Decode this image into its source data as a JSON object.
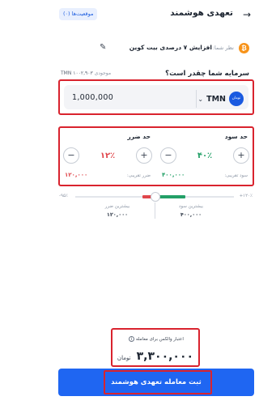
{
  "header": {
    "title": "تعهدی هوشمند",
    "positions_label": "موقعیت‌ها (۰)"
  },
  "opinion": {
    "label": "نظر شما:",
    "value": "افزایش ۷ درصدی بیت کوین",
    "coin_symbol": "₿"
  },
  "amount": {
    "question": "سرمایه شما چقدر است؟",
    "inventory_label": "موجودی",
    "inventory_value": "TMN ۱۰۰۲,۹۰۳",
    "value": "1,000,000",
    "currency": "TMN",
    "badge_text": "تومان"
  },
  "take_profit": {
    "title": "حد سود",
    "percent": "۴۰٪",
    "estimate_label": "سود تقریبی:",
    "estimate_value": "۴۰۰,۰۰۰",
    "plus": "+",
    "minus": "−"
  },
  "stop_loss": {
    "title": "حد ضرر",
    "percent": "۱۲٪",
    "estimate_label": "ضرر تقریبی:",
    "estimate_value": "۱۲۰,۰۰۰",
    "plus": "+",
    "minus": "−"
  },
  "slider": {
    "left_end": "-۹۵٪",
    "right_end": "+۱۲۰٪",
    "max_profit_label": "بیشترین سود",
    "max_profit_value": "۴۰۰,۰۰۰",
    "max_loss_label": "بیشترین ضرر",
    "max_loss_value": "۱۲۰,۰۰۰"
  },
  "summary": {
    "credit_label": "اعتبار والکس برای معامله",
    "info_icon": "i",
    "total": "۳,۳۰۰,۰۰۰",
    "unit": "تومان"
  },
  "submit": {
    "label": "ثبت معامله تعهدی هوشمند"
  },
  "colors": {
    "accent": "#1f66f2",
    "profit": "#23a067",
    "loss": "#e0474c",
    "highlight": "#d9232e"
  }
}
